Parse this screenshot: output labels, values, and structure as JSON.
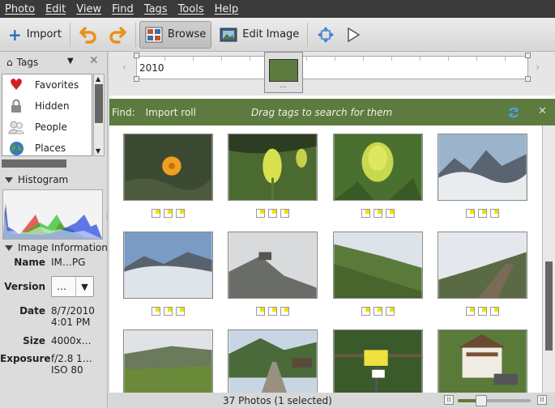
{
  "menu": [
    "Photo",
    "Edit",
    "View",
    "Find",
    "Tags",
    "Tools",
    "Help"
  ],
  "toolbar": {
    "import": "Import",
    "browse": "Browse",
    "edit_image": "Edit Image"
  },
  "tags": {
    "title": "Tags",
    "items": [
      "Favorites",
      "Hidden",
      "People",
      "Places"
    ]
  },
  "histogram": {
    "title": "Histogram"
  },
  "image_info": {
    "title": "Image Information",
    "name_label": "Name",
    "name": "IM…PG",
    "version_label": "Version",
    "version": "…",
    "date_label": "Date",
    "date_line1": "8/7/2010",
    "date_line2": "4:01 PM",
    "size_label": "Size",
    "size": "4000x…",
    "exposure_label": "Exposure",
    "exposure_line1": "f/2.8 1…",
    "exposure_line2": "ISO 80"
  },
  "timeline": {
    "year": "2010",
    "handle": "..."
  },
  "find": {
    "label": "Find:",
    "chip": "Import roll",
    "hint": "Drag tags to search for them"
  },
  "status": {
    "text": "37 Photos (1 selected)"
  },
  "colors": {
    "menubar": "#3a3a3a",
    "findbar": "#5d7b3e",
    "timeline_fill": "#5d7b3e"
  }
}
